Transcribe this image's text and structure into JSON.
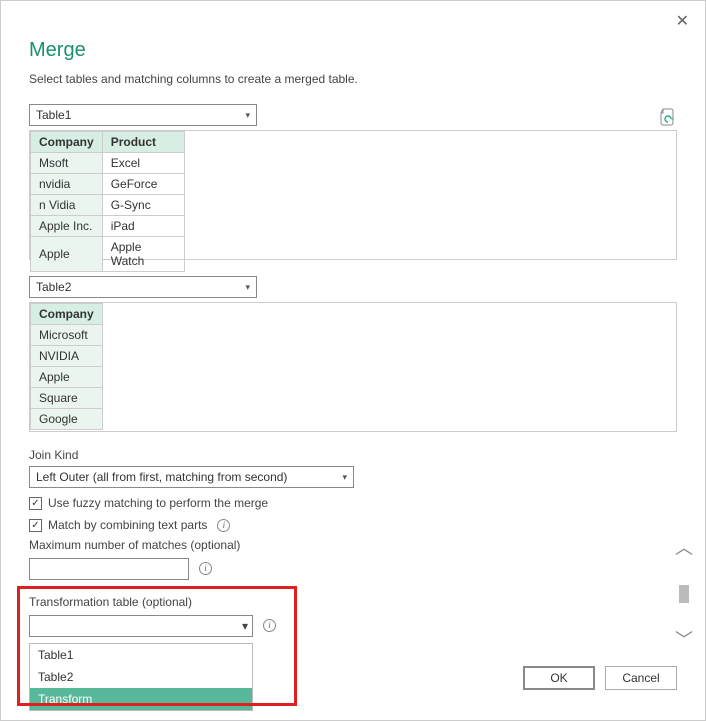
{
  "dialog": {
    "title": "Merge",
    "subtitle": "Select tables and matching columns to create a merged table."
  },
  "table1": {
    "selected": "Table1",
    "headers": {
      "company": "Company",
      "product": "Product"
    },
    "rows": [
      {
        "company": "Msoft",
        "product": "Excel"
      },
      {
        "company": "nvidia",
        "product": "GeForce"
      },
      {
        "company": "n Vidia",
        "product": "G-Sync"
      },
      {
        "company": "Apple Inc.",
        "product": "iPad"
      },
      {
        "company": "Apple",
        "product": "Apple Watch"
      }
    ]
  },
  "table2": {
    "selected": "Table2",
    "headers": {
      "company": "Company"
    },
    "rows": [
      {
        "company": "Microsoft"
      },
      {
        "company": "NVIDIA"
      },
      {
        "company": "Apple"
      },
      {
        "company": "Square"
      },
      {
        "company": "Google"
      }
    ]
  },
  "join": {
    "label": "Join Kind",
    "selected": "Left Outer (all from first, matching from second)"
  },
  "options": {
    "fuzzy_label": "Use fuzzy matching to perform the merge",
    "fuzzy_checked": true,
    "combine_label": "Match by combining text parts",
    "combine_checked": true,
    "max_matches_label": "Maximum number of matches (optional)",
    "transform_label": "Transformation table (optional)",
    "transform_options": [
      "Table1",
      "Table2",
      "Transform"
    ],
    "transform_hover": "Transform"
  },
  "buttons": {
    "ok": "OK",
    "cancel": "Cancel"
  },
  "icons": {
    "close": "✕",
    "caret": "▾",
    "check": "✓",
    "arrow_up": "︿",
    "arrow_down": "﹀"
  }
}
